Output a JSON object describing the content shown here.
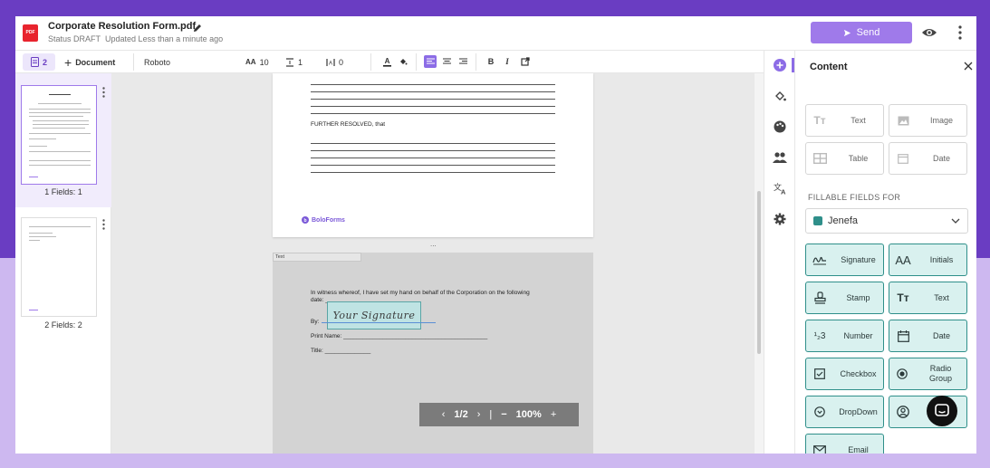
{
  "header": {
    "file_badge": "PDF",
    "title": "Corporate Resolution Form.pdf",
    "status": "Status DRAFT",
    "updated": "Updated Less than a minute ago",
    "send_label": "Send"
  },
  "toolbar": {
    "page_count": "2",
    "add_document_label": "Document",
    "font_family": "Roboto",
    "font_size_icon": "AA",
    "font_size": "10",
    "line_height": "1",
    "letter_spacing": "0",
    "bold": "B",
    "italic": "I"
  },
  "thumbnails": [
    {
      "caption": "1  Fields: 1",
      "selected": true
    },
    {
      "caption": "2  Fields: 2",
      "selected": false
    }
  ],
  "document": {
    "page1": {
      "further_resolved": "FURTHER RESOLVED, that",
      "brand": "BoloForms"
    },
    "page_divider": "...",
    "page2": {
      "text_field_label": "Text",
      "witness_line1": "In witness whereof, I have set my hand on behalf of the Corporation on the following",
      "witness_line2": "date: ___________",
      "by_label": "By:",
      "signature_placeholder": "Your Signature",
      "print_name_label": "Print Name: ____________________________________________",
      "title_label": "Title: ______________"
    },
    "pager": {
      "current": "1/2",
      "zoom": "100%"
    },
    "mini_toolbar": {
      "size": "10"
    }
  },
  "panel": {
    "title": "Content",
    "content_items": [
      "Text",
      "Image",
      "Table",
      "Date"
    ],
    "fillable_label": "FILLABLE FIELDS FOR",
    "recipient": "Jenefa",
    "recipient_color": "#2f8f8a",
    "fields": [
      "Signature",
      "Initials",
      "Stamp",
      "Text",
      "Number",
      "Date",
      "Checkbox",
      "Radio Group",
      "DropDown",
      "Name",
      "Email"
    ]
  },
  "colors": {
    "accent": "#8c6ce6",
    "send": "#9f7aea",
    "field_fill": "#d9f1ef",
    "field_border": "#2f8f8a"
  }
}
